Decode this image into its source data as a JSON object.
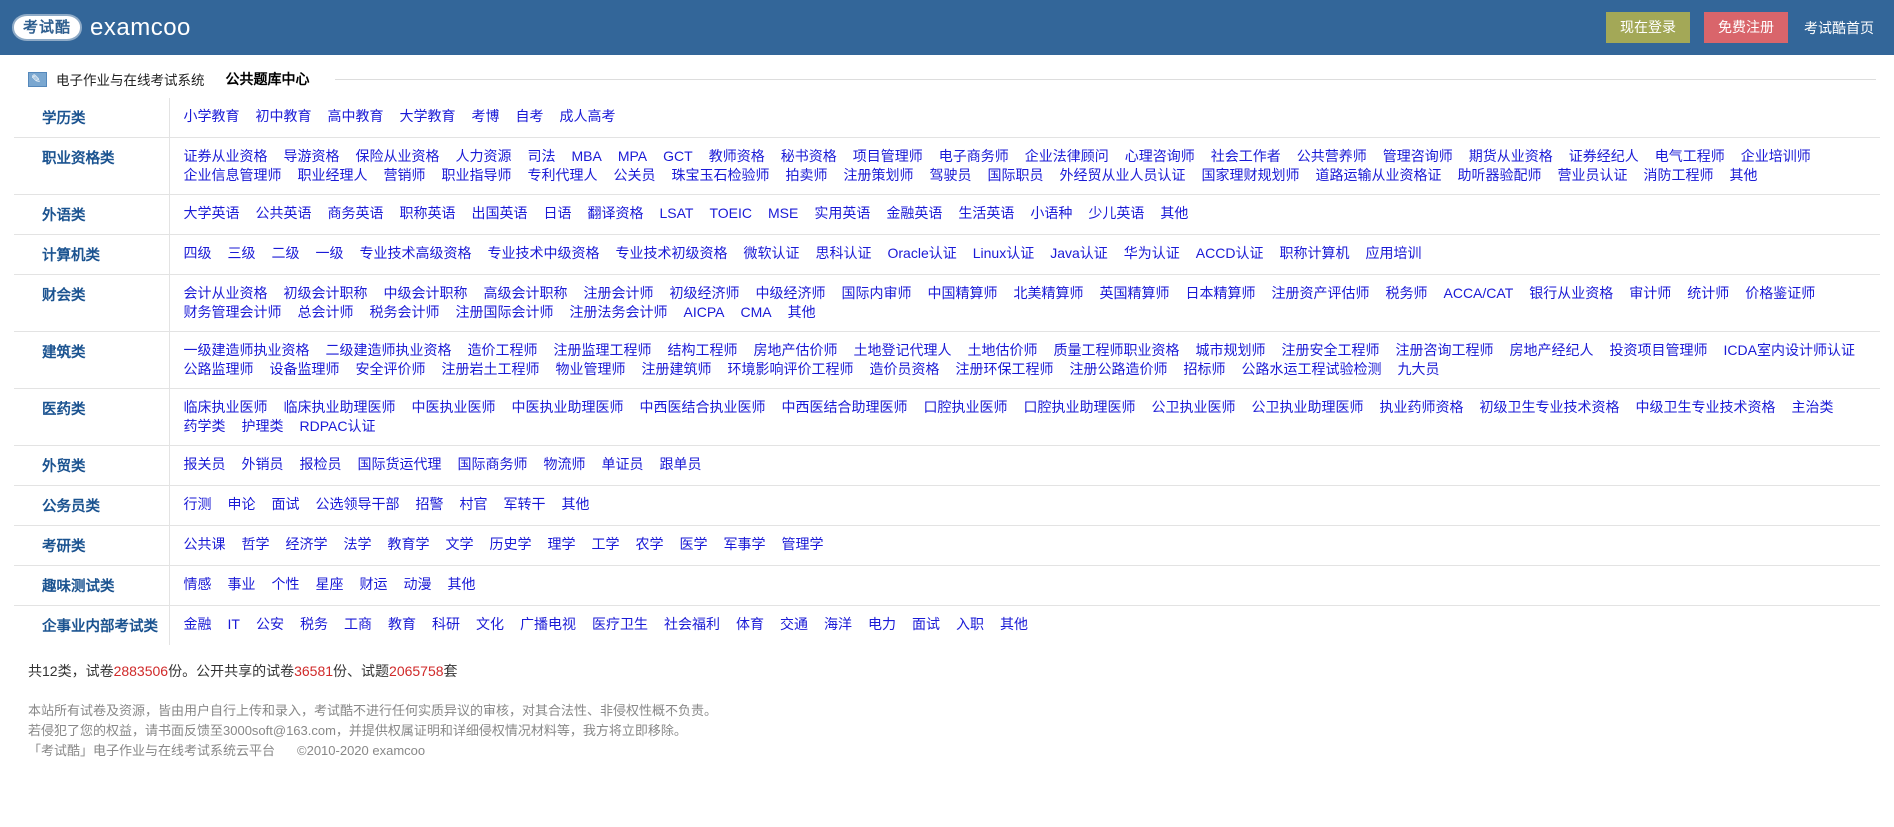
{
  "header": {
    "logo_text": "考试酷",
    "brand": "examcoo",
    "login_label": "现在登录",
    "register_label": "免费注册",
    "home_label": "考试酷首页",
    "colors": {
      "bar": "#336699",
      "login": "#a3a857",
      "register": "#d9656b"
    }
  },
  "section": {
    "system_name": "电子作业与在线考试系统",
    "center_title": "公共题库中心",
    "icon": "pencil-document-icon"
  },
  "categories": [
    {
      "name": "学历类",
      "links": [
        "小学教育",
        "初中教育",
        "高中教育",
        "大学教育",
        "考博",
        "自考",
        "成人高考"
      ]
    },
    {
      "name": "职业资格类",
      "links": [
        "证券从业资格",
        "导游资格",
        "保险从业资格",
        "人力资源",
        "司法",
        "MBA",
        "MPA",
        "GCT",
        "教师资格",
        "秘书资格",
        "项目管理师",
        "电子商务师",
        "企业法律顾问",
        "心理咨询师",
        "社会工作者",
        "公共营养师",
        "管理咨询师",
        "期货从业资格",
        "证券经纪人",
        "电气工程师",
        "企业培训师",
        "企业信息管理师",
        "职业经理人",
        "营销师",
        "职业指导师",
        "专利代理人",
        "公关员",
        "珠宝玉石检验师",
        "拍卖师",
        "注册策划师",
        "驾驶员",
        "国际职员",
        "外经贸从业人员认证",
        "国家理财规划师",
        "道路运输从业资格证",
        "助听器验配师",
        "营业员认证",
        "消防工程师",
        "其他"
      ]
    },
    {
      "name": "外语类",
      "links": [
        "大学英语",
        "公共英语",
        "商务英语",
        "职称英语",
        "出国英语",
        "日语",
        "翻译资格",
        "LSAT",
        "TOEIC",
        "MSE",
        "实用英语",
        "金融英语",
        "生活英语",
        "小语种",
        "少儿英语",
        "其他"
      ]
    },
    {
      "name": "计算机类",
      "links": [
        "四级",
        "三级",
        "二级",
        "一级",
        "专业技术高级资格",
        "专业技术中级资格",
        "专业技术初级资格",
        "微软认证",
        "思科认证",
        "Oracle认证",
        "Linux认证",
        "Java认证",
        "华为认证",
        "ACCD认证",
        "职称计算机",
        "应用培训"
      ]
    },
    {
      "name": "财会类",
      "links": [
        "会计从业资格",
        "初级会计职称",
        "中级会计职称",
        "高级会计职称",
        "注册会计师",
        "初级经济师",
        "中级经济师",
        "国际内审师",
        "中国精算师",
        "北美精算师",
        "英国精算师",
        "日本精算师",
        "注册资产评估师",
        "税务师",
        "ACCA/CAT",
        "银行从业资格",
        "审计师",
        "统计师",
        "价格鉴证师",
        "财务管理会计师",
        "总会计师",
        "税务会计师",
        "注册国际会计师",
        "注册法务会计师",
        "AICPA",
        "CMA",
        "其他"
      ]
    },
    {
      "name": "建筑类",
      "links": [
        "一级建造师执业资格",
        "二级建造师执业资格",
        "造价工程师",
        "注册监理工程师",
        "结构工程师",
        "房地产估价师",
        "土地登记代理人",
        "土地估价师",
        "质量工程师职业资格",
        "城市规划师",
        "注册安全工程师",
        "注册咨询工程师",
        "房地产经纪人",
        "投资项目管理师",
        "ICDA室内设计师认证",
        "公路监理师",
        "设备监理师",
        "安全评价师",
        "注册岩土工程师",
        "物业管理师",
        "注册建筑师",
        "环境影响评价工程师",
        "造价员资格",
        "注册环保工程师",
        "注册公路造价师",
        "招标师",
        "公路水运工程试验检测",
        "九大员"
      ]
    },
    {
      "name": "医药类",
      "links": [
        "临床执业医师",
        "临床执业助理医师",
        "中医执业医师",
        "中医执业助理医师",
        "中西医结合执业医师",
        "中西医结合助理医师",
        "口腔执业医师",
        "口腔执业助理医师",
        "公卫执业医师",
        "公卫执业助理医师",
        "执业药师资格",
        "初级卫生专业技术资格",
        "中级卫生专业技术资格",
        "主治类",
        "药学类",
        "护理类",
        "RDPAC认证"
      ]
    },
    {
      "name": "外贸类",
      "links": [
        "报关员",
        "外销员",
        "报检员",
        "国际货运代理",
        "国际商务师",
        "物流师",
        "单证员",
        "跟单员"
      ]
    },
    {
      "name": "公务员类",
      "links": [
        "行测",
        "申论",
        "面试",
        "公选领导干部",
        "招警",
        "村官",
        "军转干",
        "其他"
      ]
    },
    {
      "name": "考研类",
      "links": [
        "公共课",
        "哲学",
        "经济学",
        "法学",
        "教育学",
        "文学",
        "历史学",
        "理学",
        "工学",
        "农学",
        "医学",
        "军事学",
        "管理学"
      ]
    },
    {
      "name": "趣味测试类",
      "links": [
        "情感",
        "事业",
        "个性",
        "星座",
        "财运",
        "动漫",
        "其他"
      ]
    },
    {
      "name": "企事业内部考试类",
      "links": [
        "金融",
        "IT",
        "公安",
        "税务",
        "工商",
        "教育",
        "科研",
        "文化",
        "广播电视",
        "医疗卫生",
        "社会福利",
        "体育",
        "交通",
        "海洋",
        "电力",
        "面试",
        "入职",
        "其他"
      ]
    }
  ],
  "stats": {
    "prefix": "共12类，试卷",
    "papers_total": "2883506",
    "mid1": "份。公开共享的试卷",
    "public_papers": "36581",
    "mid2": "份、试题",
    "questions": "2065758",
    "suffix": "套"
  },
  "footer": {
    "line1": "本站所有试卷及资源，皆由用户自行上传和录入，考试酷不进行任何实质异议的审核，对其合法性、非侵权性概不负责。",
    "line2": "若侵犯了您的权益，请书面反馈至3000soft@163.com，并提供权属证明和详细侵权情况材料等，我方将立即移除。",
    "line3a": "「考试酷」电子作业与在线考试系统云平台",
    "line3b": "©2010-2020 examcoo"
  }
}
